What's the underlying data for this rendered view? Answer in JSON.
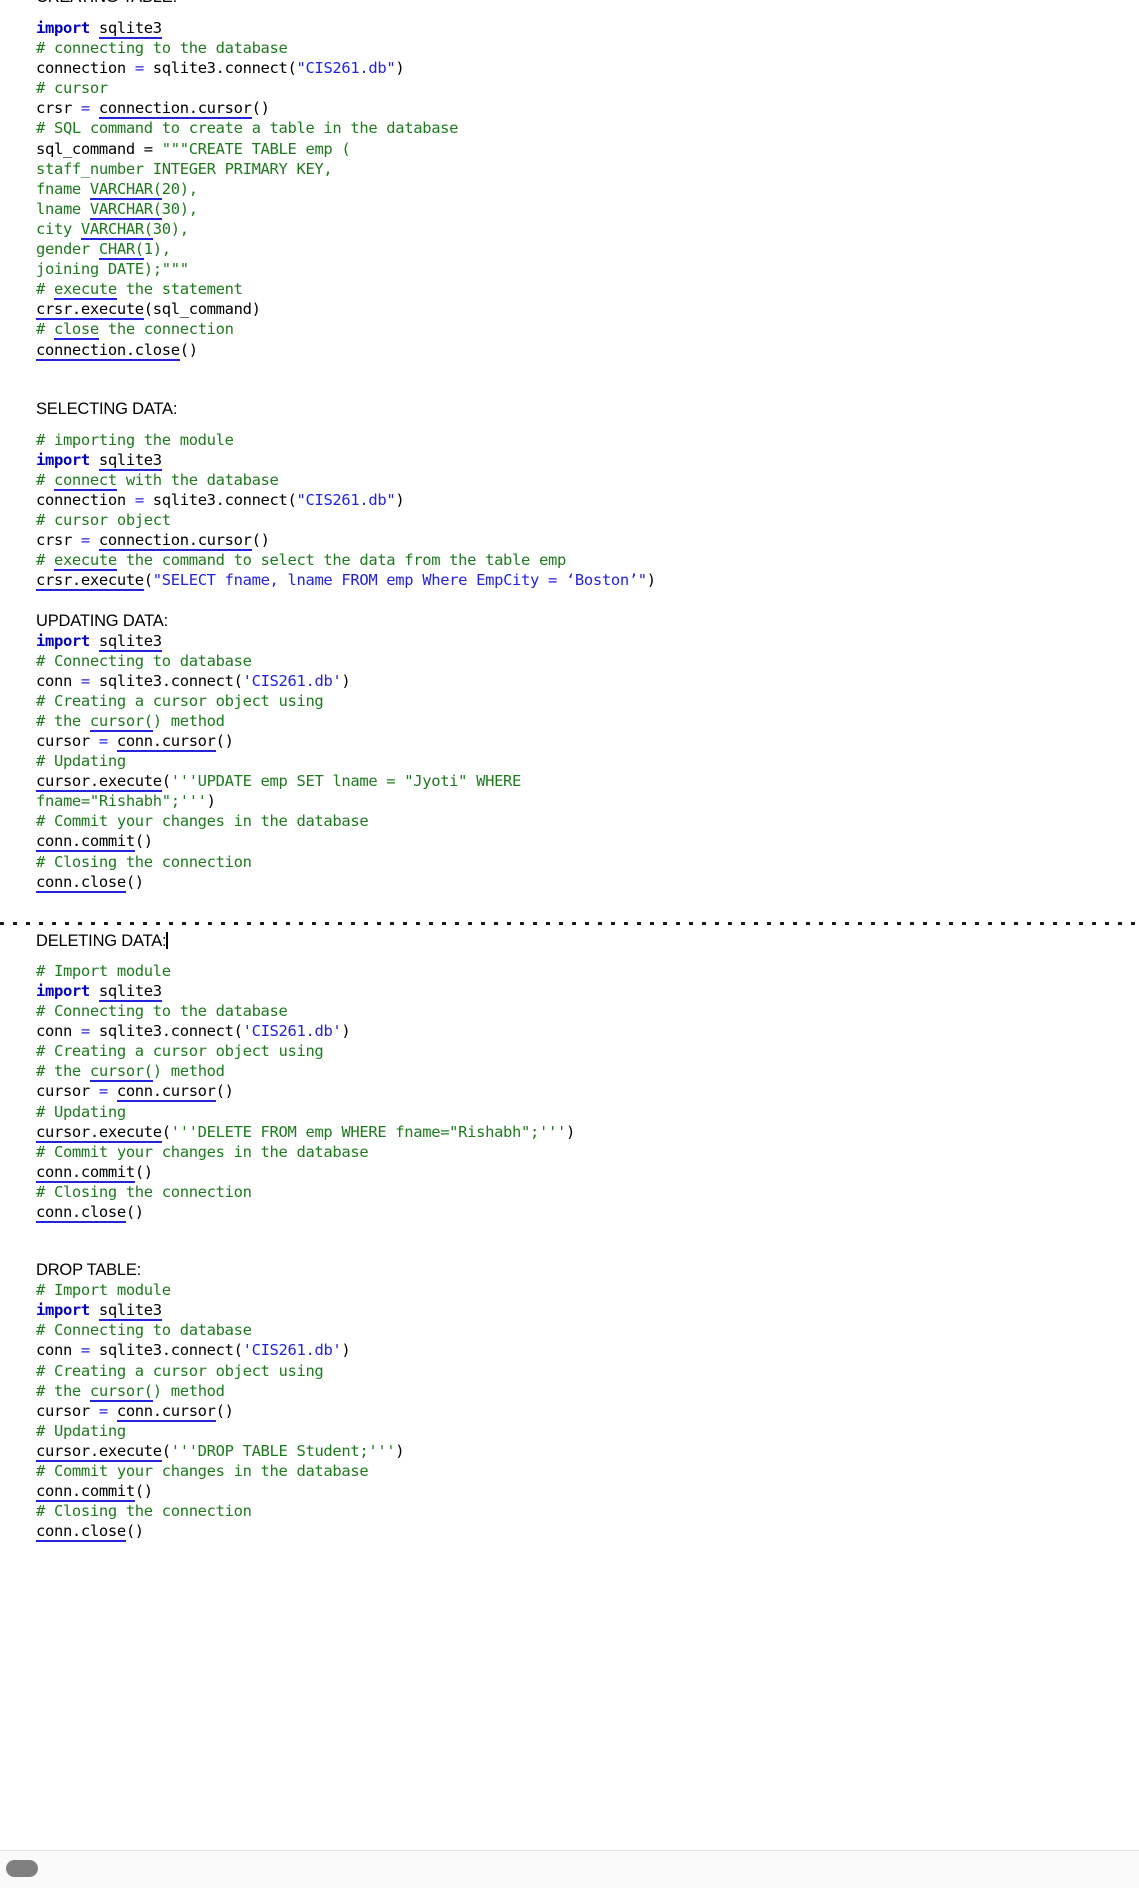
{
  "document": {
    "top_partial_heading": "CREATING TABLE:",
    "sections": [
      {
        "id": "creating-table",
        "heading": "CREATING TABLE:",
        "heading_partial": true,
        "lines": [
          "import sqlite3",
          "# connecting to the database",
          "connection = sqlite3.connect(\"CIS261.db\")",
          "# cursor",
          "crsr = connection.cursor()",
          "# SQL command to create a table in the database",
          "sql_command = \"\"\"CREATE TABLE emp (",
          "staff_number INTEGER PRIMARY KEY,",
          "fname VARCHAR(20),",
          "lname VARCHAR(30),",
          "city VARCHAR(30),",
          "gender CHAR(1),",
          "joining DATE);\"\"\"",
          "# execute the statement",
          "crsr.execute(sql_command)",
          "# close the connection",
          "connection.close()"
        ]
      },
      {
        "id": "selecting-data",
        "heading": "SELECTING DATA:",
        "lines": [
          "# importing the module",
          "import sqlite3",
          "# connect with the database",
          "connection = sqlite3.connect(\"CIS261.db\")",
          "# cursor object",
          "crsr = connection.cursor()",
          "# execute the command to select the data from the table emp",
          "crsr.execute(\"SELECT fname, lname FROM emp Where EmpCity = ‘Boston’\")"
        ]
      },
      {
        "id": "updating-data",
        "heading": "UPDATING DATA:",
        "lines": [
          "import sqlite3",
          "# Connecting to database",
          "conn = sqlite3.connect('CIS261.db')",
          "# Creating a cursor object using",
          "# the cursor() method",
          "cursor = conn.cursor()",
          "# Updating",
          "cursor.execute('''UPDATE emp SET lname = \"Jyoti\" WHERE",
          "fname=\"Rishabh\";''')",
          "# Commit your changes in the database",
          "conn.commit()",
          "# Closing the connection",
          "conn.close()"
        ]
      },
      {
        "id": "deleting-data",
        "heading": "DELETING DATA:",
        "has_caret": true,
        "lines": [
          "# Import module",
          "import sqlite3",
          "# Connecting to the database",
          "conn = sqlite3.connect('CIS261.db')",
          "# Creating a cursor object using",
          "# the cursor() method",
          "cursor = conn.cursor()",
          "# Updating",
          "cursor.execute('''DELETE FROM emp WHERE fname=\"Rishabh\";''')",
          "# Commit your changes in the database",
          "conn.commit()",
          "# Closing the connection",
          "conn.close()"
        ]
      },
      {
        "id": "drop-table",
        "heading": "DROP TABLE:",
        "lines": [
          "# Import module",
          "import sqlite3",
          "# Connecting to database",
          "conn = sqlite3.connect('CIS261.db')",
          "# Creating a cursor object using",
          "# the cursor() method",
          "cursor = conn.cursor()",
          "# Updating",
          "cursor.execute('''DROP TABLE Student;''')",
          "# Commit your changes in the database",
          "conn.commit()",
          "# Closing the connection",
          "conn.close()"
        ]
      }
    ],
    "page_break_label": "page-break"
  },
  "colors": {
    "keyword": "#0000c0",
    "comment": "#1f7a1f",
    "string": "#2323dc",
    "sql_literal": "#1f7a1f",
    "text": "#000000",
    "spellcheck_underline": "#2323dc",
    "scrollbar_thumb": "#808080",
    "scrollbar_track": "#fafafa"
  },
  "scrollbar": {
    "orientation": "horizontal",
    "thumb_position": "left"
  }
}
